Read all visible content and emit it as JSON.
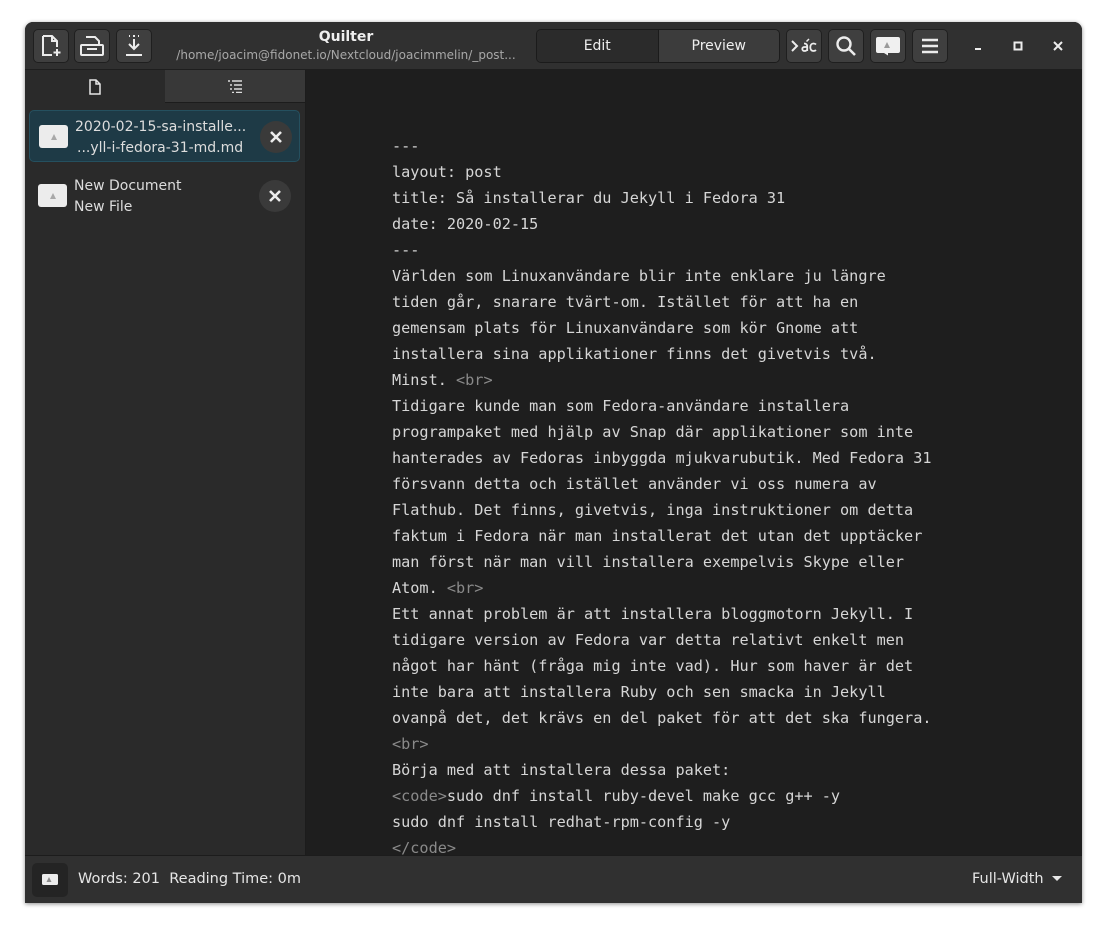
{
  "window": {
    "title": "Quilter",
    "subtitle": "/home/joacim@fidonet.io/Nextcloud/joacimmelin/_post..."
  },
  "header": {
    "mode_tabs": [
      {
        "label": "Edit",
        "active": true
      },
      {
        "label": "Preview",
        "active": false
      }
    ],
    "icons": [
      "new-document-icon",
      "open-document-icon",
      "save-icon",
      "focus-mode-icon",
      "search-icon",
      "image-preview-icon",
      "menu-icon",
      "minimize-icon",
      "maximize-icon",
      "close-icon"
    ]
  },
  "sidebar": {
    "tabs": [
      "document-icon",
      "outline-icon"
    ],
    "documents": [
      {
        "line1": "2020-02-15-sa-installe...",
        "line2": "...yll-i-fedora-31-md.md",
        "selected": true
      },
      {
        "line1": "New Document",
        "line2": "New File",
        "selected": false
      }
    ]
  },
  "editor": {
    "lines": [
      {
        "text": "---"
      },
      {
        "text": "layout: post"
      },
      {
        "text": "title: Så installerar du Jekyll i Fedora 31"
      },
      {
        "text": "date: 2020-02-15"
      },
      {
        "text": "---"
      },
      {
        "text": "Världen som Linuxanvändare blir inte enklare ju längre"
      },
      {
        "text": "tiden går, snarare tvärt-om. Istället för att ha en"
      },
      {
        "text": "gemensam plats för Linuxanvändare som kör Gnome att"
      },
      {
        "text": "installera sina applikationer finns det givetvis två."
      },
      {
        "text": "Minst. ",
        "tag": "<br>"
      },
      {
        "text": "Tidigare kunde man som Fedora-användare installera"
      },
      {
        "text": "programpaket med hjälp av Snap där applikationer som inte"
      },
      {
        "text": "hanterades av Fedoras inbyggda mjukvarubutik. Med Fedora 31"
      },
      {
        "text": "försvann detta och istället använder vi oss numera av"
      },
      {
        "text": "Flathub. Det finns, givetvis, inga instruktioner om detta"
      },
      {
        "text": "faktum i Fedora när man installerat det utan det upptäcker"
      },
      {
        "text": "man först när man vill installera exempelvis Skype eller"
      },
      {
        "text": "Atom. ",
        "tag": "<br>"
      },
      {
        "text": "Ett annat problem är att installera bloggmotorn Jekyll. I"
      },
      {
        "text": "tidigare version av Fedora var detta relativt enkelt men"
      },
      {
        "text": "något har hänt (fråga mig inte vad). Hur som haver är det"
      },
      {
        "text": "inte bara att installera Ruby och sen smacka in Jekyll"
      },
      {
        "text": "ovanpå det, det krävs en del paket för att det ska fungera."
      },
      {
        "text": "",
        "tag": "<br>"
      },
      {
        "text": "Börja med att installera dessa paket:"
      },
      {
        "tag_before": "<code>",
        "text": "sudo dnf install ruby-devel make gcc g++ -y"
      },
      {
        "text": "sudo dnf install redhat-rpm-config -y"
      },
      {
        "text": "",
        "tag": "</code>"
      }
    ]
  },
  "status": {
    "words_label": "Words: 201",
    "reading_label": "Reading Time: 0m",
    "width_mode": "Full-Width"
  },
  "colors": {
    "headerbar": "#303030",
    "sidebar": "#2a2a2a",
    "editor_bg": "#1e1e1e",
    "selected_row": "#1e3a46",
    "markup_tag": "#8a8a8a"
  }
}
